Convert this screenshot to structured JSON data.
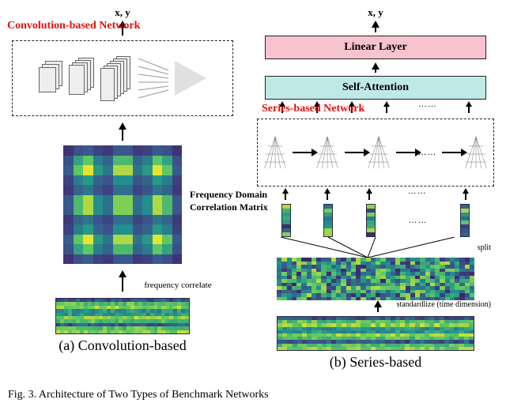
{
  "output_label": "x, y",
  "panel_a": {
    "net_label": "Convolution-based Network",
    "corr_label_line1": "Frequency Domain",
    "corr_label_line2": "Correlation Matrix",
    "freq_corr_label": "frequency correlate",
    "sublabel": "(a) Convolution-based"
  },
  "panel_b": {
    "linear_label": "Linear Layer",
    "attn_label": "Self-Attention",
    "net_label": "Series-based Network",
    "ellipsis": "……",
    "split_label": "split",
    "std_label": "standardlize (time dimension)",
    "sublabel": "(b) Series-based"
  },
  "caption": "Fig. 3.   Architecture of Two Types of Benchmark Networks"
}
